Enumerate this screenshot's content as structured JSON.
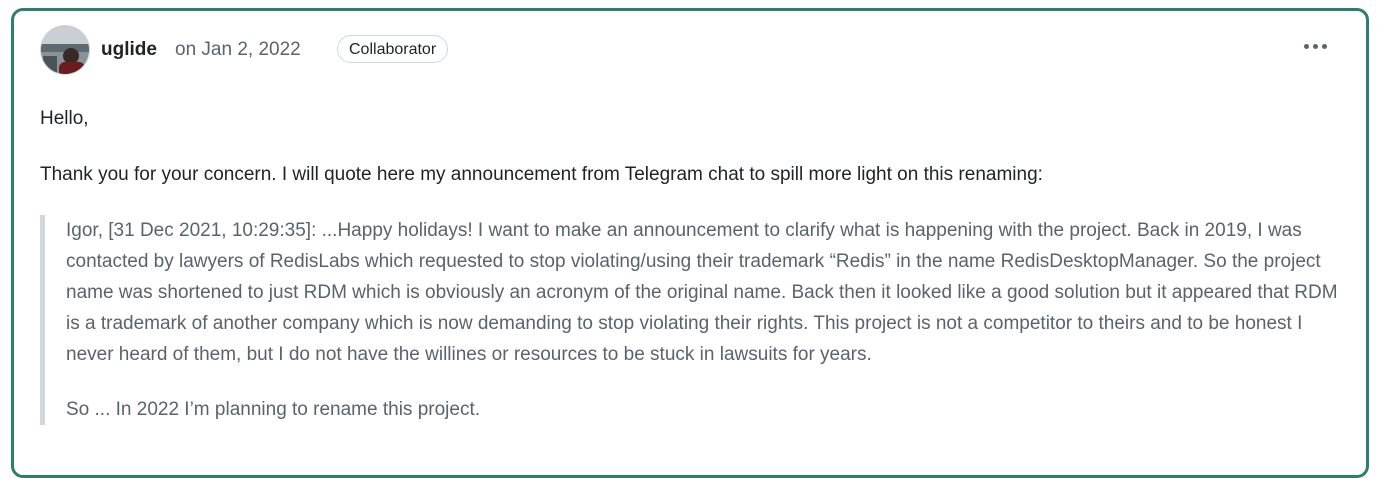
{
  "comment": {
    "author": "uglide",
    "date": "on Jan 2, 2022",
    "badge": "Collaborator",
    "paragraphs": [
      "Hello,",
      "Thank you for your concern. I will quote here my announcement from Telegram chat to spill more light on this renaming:"
    ],
    "quote": [
      "Igor, [31 Dec 2021, 10:29:35]: ...Happy holidays! I want to make an announcement to clarify what is happening with the project. Back in 2019, I was contacted by lawyers of RedisLabs which requested to stop violating/using their trademark “Redis” in the name RedisDesktopManager. So the project name was shortened to just RDM which is obviously an acronym of the original name. Back then it looked like a good solution but it appeared that RDM is a trademark of another company which is now demanding to stop violating their rights. This project is not a competitor to theirs and to be honest I never heard of them, but I do not have the willines or resources to be stuck in lawsuits for years.",
      "So ... In 2022 I’m planning to rename this project."
    ]
  },
  "icons": {
    "menu": "kebab-horizontal-icon",
    "avatar": "user-avatar"
  },
  "colors": {
    "card_border": "#2f7d6d",
    "text": "#1f2328",
    "muted": "#59636e",
    "quote_bar": "#d0d7de"
  }
}
